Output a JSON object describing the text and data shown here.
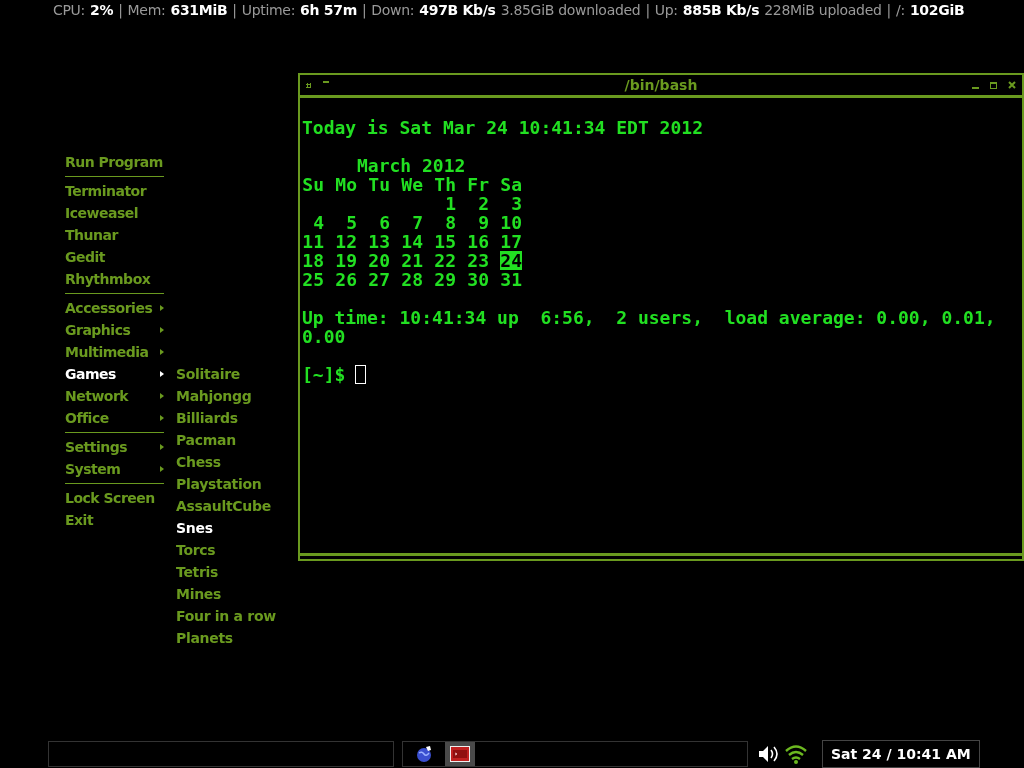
{
  "status_bar": [
    {
      "kind": "label",
      "text": "CPU:"
    },
    {
      "kind": "value",
      "text": "2%"
    },
    {
      "kind": "sep",
      "text": "|"
    },
    {
      "kind": "label",
      "text": "Mem:"
    },
    {
      "kind": "value",
      "text": "631MiB"
    },
    {
      "kind": "sep",
      "text": "|"
    },
    {
      "kind": "label",
      "text": "Uptime:"
    },
    {
      "kind": "value",
      "text": "6h 57m"
    },
    {
      "kind": "sep",
      "text": "|"
    },
    {
      "kind": "label",
      "text": "Down:"
    },
    {
      "kind": "value",
      "text": "497B Kb/s"
    },
    {
      "kind": "label",
      "text": "3.85GiB downloaded"
    },
    {
      "kind": "sep",
      "text": "|"
    },
    {
      "kind": "label",
      "text": "Up:"
    },
    {
      "kind": "value",
      "text": "885B Kb/s"
    },
    {
      "kind": "label",
      "text": "228MiB uploaded"
    },
    {
      "kind": "sep",
      "text": "|"
    },
    {
      "kind": "label",
      "text": "/:"
    },
    {
      "kind": "value",
      "text": "102GiB"
    }
  ],
  "menu": [
    {
      "kind": "item",
      "label": "Run Program",
      "selected": false
    },
    {
      "kind": "separator"
    },
    {
      "kind": "item",
      "label": "Terminator",
      "selected": false
    },
    {
      "kind": "item",
      "label": "Iceweasel",
      "selected": false
    },
    {
      "kind": "item",
      "label": "Thunar",
      "selected": false
    },
    {
      "kind": "item",
      "label": "Gedit",
      "selected": false
    },
    {
      "kind": "item",
      "label": "Rhythmbox",
      "selected": false
    },
    {
      "kind": "separator"
    },
    {
      "kind": "submenu",
      "label": "Accessories",
      "selected": false
    },
    {
      "kind": "submenu",
      "label": "Graphics",
      "selected": false
    },
    {
      "kind": "submenu",
      "label": "Multimedia",
      "selected": false
    },
    {
      "kind": "submenu",
      "label": "Games",
      "selected": true,
      "children": [
        {
          "label": "Solitaire",
          "selected": false
        },
        {
          "label": "Mahjongg",
          "selected": false
        },
        {
          "label": "Billiards",
          "selected": false
        },
        {
          "label": "Pacman",
          "selected": false
        },
        {
          "label": "Chess",
          "selected": false
        },
        {
          "label": "Playstation",
          "selected": false
        },
        {
          "label": "AssaultCube",
          "selected": false
        },
        {
          "label": "Snes",
          "selected": true
        },
        {
          "label": "Torcs",
          "selected": false
        },
        {
          "label": "Tetris",
          "selected": false
        },
        {
          "label": "Mines",
          "selected": false
        },
        {
          "label": "Four in a row",
          "selected": false
        },
        {
          "label": "Planets",
          "selected": false
        }
      ]
    },
    {
      "kind": "submenu",
      "label": "Network",
      "selected": false
    },
    {
      "kind": "submenu",
      "label": "Office",
      "selected": false
    },
    {
      "kind": "separator"
    },
    {
      "kind": "submenu",
      "label": "Settings",
      "selected": false
    },
    {
      "kind": "submenu",
      "label": "System",
      "selected": false
    },
    {
      "kind": "separator"
    },
    {
      "kind": "item",
      "label": "Lock Screen",
      "selected": false
    },
    {
      "kind": "item",
      "label": "Exit",
      "selected": false
    }
  ],
  "terminal": {
    "title": "/bin/bash",
    "greeting": "Today is Sat Mar 24 10:41:34 EDT 2012",
    "calendar": {
      "title": "March 2012",
      "weekdays": [
        "Su",
        "Mo",
        "Tu",
        "We",
        "Th",
        "Fr",
        "Sa"
      ],
      "weeks": [
        [
          {
            "day": "1",
            "selected": false
          },
          {
            "day": "2",
            "selected": false
          },
          {
            "day": "3",
            "selected": false
          }
        ],
        [
          {
            "day": "4",
            "selected": false
          },
          {
            "day": "5",
            "selected": false
          },
          {
            "day": "6",
            "selected": false
          },
          {
            "day": "7",
            "selected": false
          },
          {
            "day": "8",
            "selected": false
          },
          {
            "day": "9",
            "selected": false
          },
          {
            "day": "10",
            "selected": false
          }
        ],
        [
          {
            "day": "11",
            "selected": false
          },
          {
            "day": "12",
            "selected": false
          },
          {
            "day": "13",
            "selected": false
          },
          {
            "day": "14",
            "selected": false
          },
          {
            "day": "15",
            "selected": false
          },
          {
            "day": "16",
            "selected": false
          },
          {
            "day": "17",
            "selected": false
          }
        ],
        [
          {
            "day": "18",
            "selected": false
          },
          {
            "day": "19",
            "selected": false
          },
          {
            "day": "20",
            "selected": false
          },
          {
            "day": "21",
            "selected": false
          },
          {
            "day": "22",
            "selected": false
          },
          {
            "day": "23",
            "selected": false
          },
          {
            "day": "24",
            "selected": true
          }
        ],
        [
          {
            "day": "25",
            "selected": false
          },
          {
            "day": "26",
            "selected": false
          },
          {
            "day": "27",
            "selected": false
          },
          {
            "day": "28",
            "selected": false
          },
          {
            "day": "29",
            "selected": false
          },
          {
            "day": "30",
            "selected": false
          },
          {
            "day": "31",
            "selected": false
          }
        ]
      ]
    },
    "uptime": "Up time: 10:41:34 up  6:56,  2 users,  load average: 0.00, 0.01, 0.00",
    "prompt": "[~]$"
  },
  "taskbar": {
    "tasks": [
      {
        "kind": "globe",
        "selected": false
      },
      {
        "kind": "terminal",
        "selected": true
      }
    ],
    "clock": "Sat 24 / 10:41 AM"
  }
}
